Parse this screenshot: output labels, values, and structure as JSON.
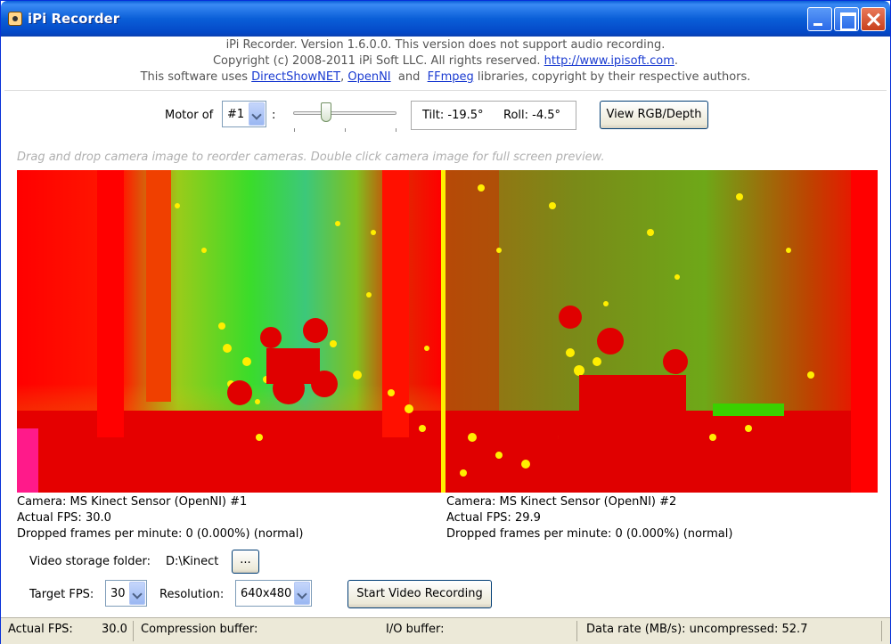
{
  "window": {
    "title": "iPi Recorder"
  },
  "header": {
    "line1": "iPi Recorder. Version 1.6.0.0. This version does not support audio recording.",
    "copyright": "Copyright (c) 2008-2011 iPi Soft LLC. All rights reserved.",
    "website": "http://www.ipisoft.com",
    "website_suffix": ".",
    "uses_prefix": "This software uses",
    "lib1": "DirectShowNET",
    "comma": ",",
    "lib2": "OpenNI",
    "and": "and",
    "lib3": "FFmpeg",
    "uses_suffix": "libraries, copyright by their respective authors."
  },
  "motor": {
    "label": "Motor of",
    "selected": "#1",
    "colon": ":",
    "slider_value_fraction": 0.3,
    "tilt": "Tilt: -19.5°",
    "roll": "Roll: -4.5°",
    "view_button": "View RGB/Depth"
  },
  "hint": "Drag and drop camera image to reorder cameras. Double click camera image for full screen preview.",
  "cameras": [
    {
      "name": "Camera: MS Kinect Sensor (OpenNI) #1",
      "fps": "Actual FPS: 30.0",
      "dropped": "Dropped frames per minute: 0 (0.000%) (normal)"
    },
    {
      "name": "Camera: MS Kinect Sensor (OpenNI) #2",
      "fps": "Actual FPS: 29.9",
      "dropped": "Dropped frames per minute: 0 (0.000%) (normal)"
    }
  ],
  "storage": {
    "label": "Video storage folder:",
    "path": "D:\\Kinect",
    "browse": "..."
  },
  "settings": {
    "fps_label": "Target FPS:",
    "fps_value": "30",
    "res_label": "Resolution:",
    "res_value": "640x480",
    "start_button": "Start Video Recording"
  },
  "status": {
    "fps_label": "Actual FPS:",
    "fps_value": "30.0",
    "compression": "Compression buffer:",
    "io": "I/O buffer:",
    "datarate": "Data rate (MB/s):  uncompressed:  52.7"
  },
  "colors": {
    "depth_near": "#ff0000",
    "depth_mid": "#55dd22",
    "depth_far": "#22cc55",
    "depth_edge": "#ffee00",
    "link": "#1a3bd1"
  }
}
